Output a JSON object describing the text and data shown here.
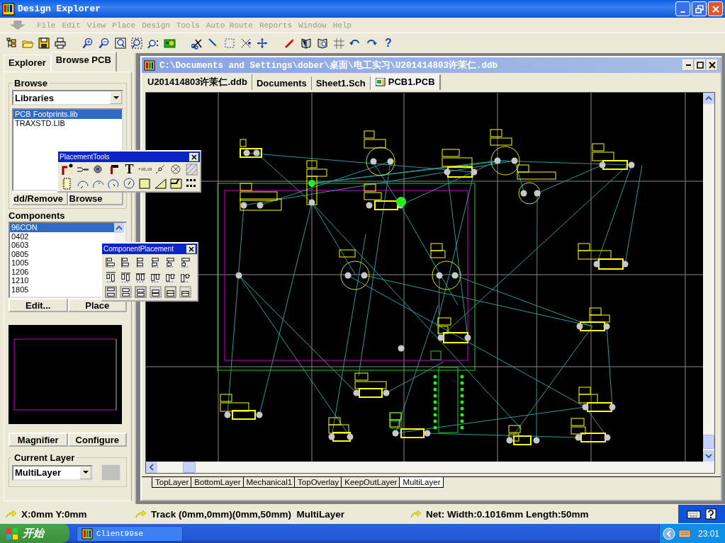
{
  "window": {
    "title": "Design Explorer"
  },
  "menu": [
    {
      "label": "File",
      "disabled": true
    },
    {
      "label": "Edit",
      "disabled": true
    },
    {
      "label": "View",
      "disabled": true
    },
    {
      "label": "Place",
      "disabled": true
    },
    {
      "label": "Design",
      "disabled": true
    },
    {
      "label": "Tools",
      "disabled": true
    },
    {
      "label": "Auto Route",
      "disabled": true
    },
    {
      "label": "Reports",
      "disabled": true
    },
    {
      "label": "Window",
      "disabled": true
    },
    {
      "label": "Help",
      "disabled": true
    }
  ],
  "toolbar": {
    "help_glyph": "?"
  },
  "panel": {
    "tabs": [
      {
        "label": "Explorer",
        "selected": false
      },
      {
        "label": "Browse PCB",
        "selected": true
      }
    ],
    "browse": {
      "title": "Browse",
      "dropdown": "Libraries",
      "items": [
        {
          "label": "PCB Footprints.lib",
          "selected": true
        },
        {
          "label": "TRAXSTD.LIB",
          "selected": false
        }
      ],
      "buttons": [
        "dd/Remove",
        "Browse"
      ]
    },
    "components": {
      "title": "Components",
      "items": [
        {
          "label": "96CON",
          "selected": true
        },
        {
          "label": "0402",
          "selected": false
        },
        {
          "label": "0603",
          "selected": false
        },
        {
          "label": "0805",
          "selected": false
        },
        {
          "label": "1005",
          "selected": false
        },
        {
          "label": "1206",
          "selected": false
        },
        {
          "label": "1210",
          "selected": false
        },
        {
          "label": "1805",
          "selected": false
        }
      ],
      "buttons": [
        "Edit...",
        "Place"
      ]
    },
    "view_buttons": [
      "Magnifier",
      "Configure"
    ],
    "current_layer": {
      "title": "Current Layer",
      "dropdown": "MultiLayer"
    }
  },
  "document": {
    "title": "C:\\Documents and Settings\\dober\\桌面\\电工实习\\U201414803许茉仁.ddb",
    "tabs": [
      {
        "label": "U201414803许茉仁.ddb",
        "selected": false
      },
      {
        "label": "Documents",
        "selected": false
      },
      {
        "label": "Sheet1.Sch",
        "selected": false
      },
      {
        "label": "PCB1.PCB",
        "selected": true
      }
    ],
    "layer_tabs": [
      {
        "label": "TopLayer",
        "selected": false
      },
      {
        "label": "BottomLayer",
        "selected": false
      },
      {
        "label": "Mechanical1",
        "selected": false
      },
      {
        "label": "TopOverlay",
        "selected": false
      },
      {
        "label": "KeepOutLayer",
        "selected": false
      },
      {
        "label": "MultiLayer",
        "selected": true
      }
    ]
  },
  "placement_tools": {
    "title": "PlacementTools",
    "text_glyph": "T",
    "coordinate_glyph": "+10,10"
  },
  "component_placement": {
    "title": "ComponentPlacement"
  },
  "status_bar": [
    "X:0mm Y:0mm",
    "Track (0mm,0mm)(0mm,50mm)  MultiLayer",
    "Net: Width:0.1016mm Length:50mm"
  ],
  "taskbar": {
    "start": "开始",
    "task": "Client99se",
    "clock": "23:01"
  }
}
